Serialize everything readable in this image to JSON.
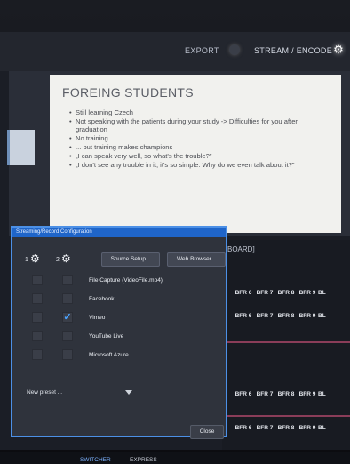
{
  "topbar": {
    "export_label": "EXPORT",
    "stream_label": "STREAM / ENCODE"
  },
  "slide": {
    "title": "FOREING STUDENTS",
    "bullets": [
      "Still learning Czech",
      "Not speaking with the patients during your study -> Difficulties for you after graduation",
      "No training",
      "... but training makes champions",
      "„I can speak very well, so what's the trouble?”",
      "„I don't see any trouble in it, it's so simple. Why do we even talk about it?”"
    ]
  },
  "board": {
    "label": "BOARD]",
    "rows": [
      [
        "BFR 6",
        "BFR 7",
        "BFR 8",
        "BFR 9",
        "BL"
      ],
      [
        "BFR 6",
        "BFR 7",
        "BFR 8",
        "BFR 9",
        "BL"
      ],
      [
        "BFR 6",
        "BFR 7",
        "BFR 8",
        "BFR 9",
        "BL"
      ],
      [
        "BFR 6",
        "BFR 7",
        "BFR 8",
        "BFR 9",
        "BL"
      ]
    ]
  },
  "dialog": {
    "title": "Streaming/Record Configuration",
    "config_1": "1",
    "config_2": "2",
    "source_setup": "Source Setup...",
    "web_browser": "Web Browser...",
    "services": [
      {
        "label": "File Capture (VideoFile.mp4)",
        "checked": false
      },
      {
        "label": "Facebook",
        "checked": false
      },
      {
        "label": "Vimeo",
        "checked": true
      },
      {
        "label": "YouTube Live",
        "checked": false
      },
      {
        "label": "Microsoft Azure",
        "checked": false
      }
    ],
    "preset_value": "New preset ...",
    "close_label": "Close",
    "check_mark": "✓"
  },
  "bottom_tabs": {
    "switcher": "SWITCHER",
    "express": "EXPRESS"
  },
  "colors": {
    "accent_blue": "#1f65c9",
    "check_blue": "#4aa3ff",
    "row_line": "#8a3d59"
  }
}
